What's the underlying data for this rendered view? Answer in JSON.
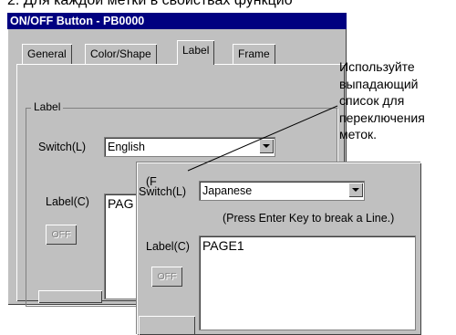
{
  "doc": {
    "line_text": "2.    Для каждой метки в свойствах функцио"
  },
  "back_dialog": {
    "title": "ON/OFF Button - PB0000",
    "tabs": [
      "General",
      "Color/Shape",
      "Label",
      "Frame"
    ],
    "active_tab": "Label",
    "group_title": "Label",
    "switch_label": "Switch(L)",
    "switch_value": "English",
    "hint_partial": "(P",
    "label_label": "Label(C)",
    "label_text": "PAG",
    "off_button": "OFF"
  },
  "front_dialog": {
    "switch_label": "Switch(L)",
    "switch_partial_left": "(F",
    "switch_value": "Japanese",
    "hint": "(Press Enter Key to break a Line.)",
    "label_label": "Label(C)",
    "label_text": "PAGE1",
    "off_button": "OFF"
  },
  "annotation": {
    "text": "Используйте\nвыпадающий\nсписок для\nпереключения\nметок."
  },
  "colors": {
    "dialog_bg": "#c0c0c0",
    "title_bg": "#000080"
  }
}
